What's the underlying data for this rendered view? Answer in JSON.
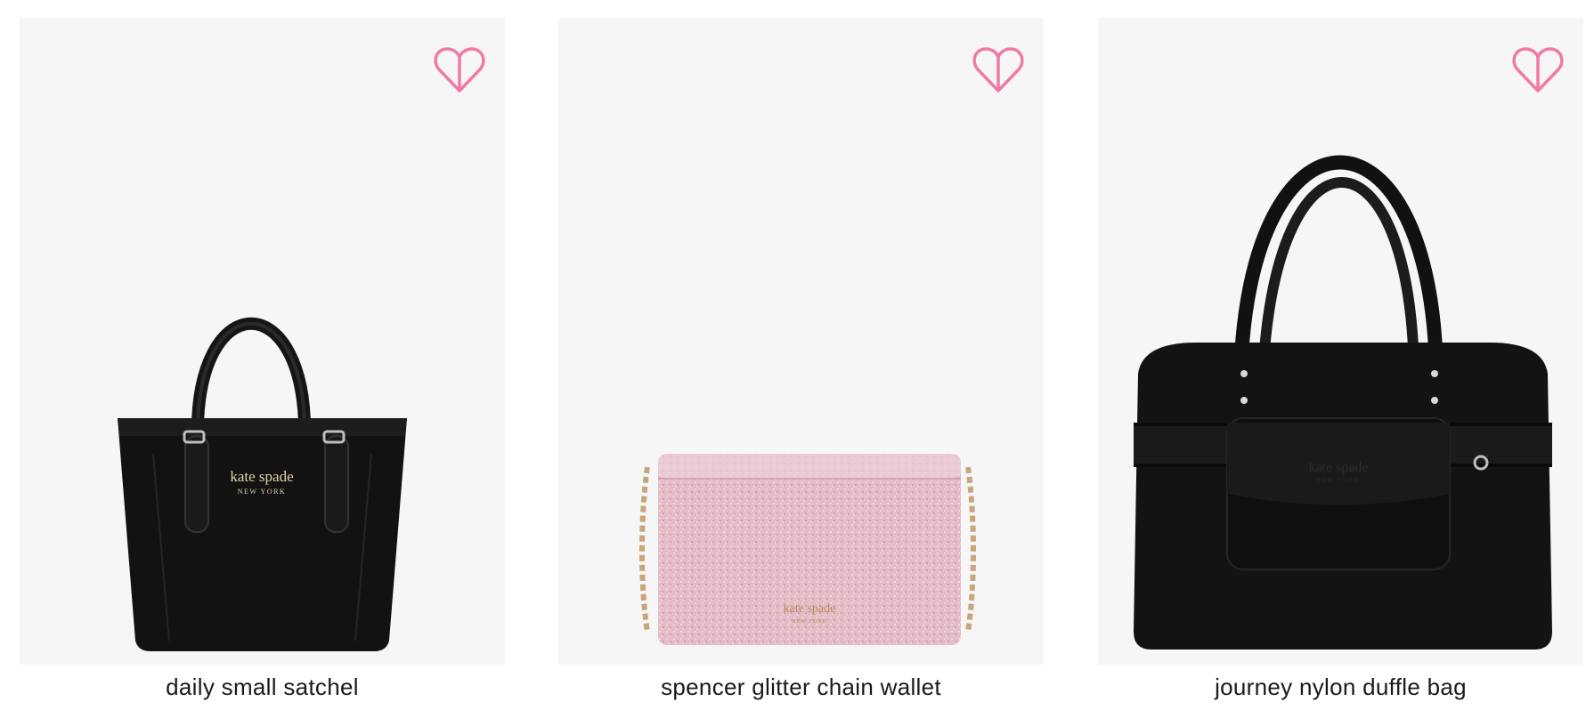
{
  "colors": {
    "tile_background": "#f6f6f6",
    "wishlist_accent": "#f07aa6",
    "text": "#1a1a1a"
  },
  "products": [
    {
      "name": "daily small satchel",
      "logo_text": "kate spade",
      "logo_subtext": "NEW YORK",
      "image": "black-nylon-satchel",
      "wishlist_icon": "heart-outline-icon"
    },
    {
      "name": "spencer glitter chain wallet",
      "logo_text": "kate spade",
      "logo_subtext": "NEW YORK",
      "image": "pink-glitter-chain-wallet",
      "wishlist_icon": "heart-outline-icon"
    },
    {
      "name": "journey nylon duffle bag",
      "logo_text": "kate spade",
      "logo_subtext": "NEW YORK",
      "image": "black-nylon-duffle-bag",
      "wishlist_icon": "heart-outline-icon"
    }
  ]
}
